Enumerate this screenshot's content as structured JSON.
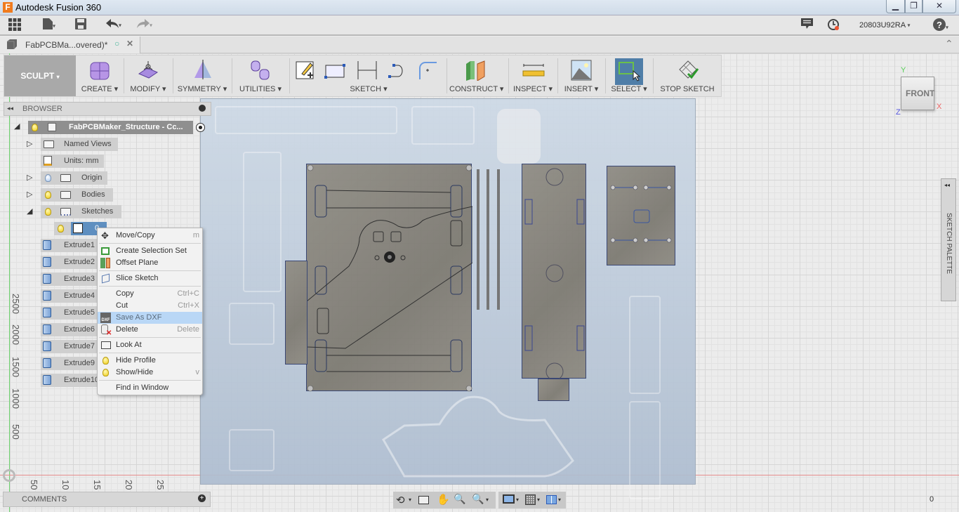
{
  "window": {
    "app_title": "Autodesk Fusion 360",
    "logo_letter": "F",
    "minimize": "▁",
    "restore": "❐",
    "close": "✕"
  },
  "app_toolbar": {
    "user": "20803U92RA",
    "icons": [
      "apps-grid-icon",
      "file-icon",
      "save-icon",
      "undo-icon",
      "redo-icon",
      "notifications-icon",
      "job-status-icon",
      "help-icon"
    ]
  },
  "doc_tab": {
    "name": "FabPCBMa...overed)*",
    "status_glyph": "○",
    "close_glyph": "✕",
    "collapse_glyph": "⌃"
  },
  "ribbon": {
    "workspace": "SCULPT",
    "groups": [
      {
        "label": "CREATE"
      },
      {
        "label": "MODIFY"
      },
      {
        "label": "SYMMETRY"
      },
      {
        "label": "UTILITIES"
      },
      {
        "label": "SKETCH"
      },
      {
        "label": "CONSTRUCT"
      },
      {
        "label": "INSPECT"
      },
      {
        "label": "INSERT"
      },
      {
        "label": "SELECT"
      },
      {
        "label": "STOP SKETCH"
      }
    ],
    "caret": "▾"
  },
  "browser": {
    "title": "BROWSER",
    "collapse_glyph": "◂◂",
    "root": "FabPCBMaker_Structure - Cc...",
    "items": [
      {
        "label": "Named Views"
      },
      {
        "label": "Units: mm"
      },
      {
        "label": "Origin"
      },
      {
        "label": "Bodies"
      },
      {
        "label": "Sketches"
      },
      {
        "label": "0"
      }
    ],
    "extrudes": [
      "Extrude1",
      "Extrude2",
      "Extrude3",
      "Extrude4",
      "Extrude5",
      "Extrude6",
      "Extrude7",
      "Extrude9",
      "Extrude10"
    ]
  },
  "context_menu": {
    "items": [
      {
        "label": "Move/Copy",
        "shortcut": "m"
      },
      {
        "label": "Create Selection Set",
        "shortcut": ""
      },
      {
        "label": "Offset Plane",
        "shortcut": ""
      },
      {
        "label": "Slice Sketch",
        "shortcut": ""
      },
      {
        "label": "Copy",
        "shortcut": "Ctrl+C"
      },
      {
        "label": "Cut",
        "shortcut": "Ctrl+X"
      },
      {
        "label": "Save As DXF",
        "shortcut": ""
      },
      {
        "label": "Delete",
        "shortcut": "Delete"
      },
      {
        "label": "Look At",
        "shortcut": ""
      },
      {
        "label": "Hide Profile",
        "shortcut": ""
      },
      {
        "label": "Show/Hide",
        "shortcut": "v"
      },
      {
        "label": "Find in Window",
        "shortcut": ""
      }
    ],
    "highlighted": "Save As DXF"
  },
  "viewcube": {
    "face": "FRONT",
    "axis_x": "X",
    "axis_y": "Y",
    "axis_z": "Z"
  },
  "sketch_palette": {
    "label": "SKETCH PALETTE",
    "collapse_glyph": "◂◂"
  },
  "rulers": {
    "vertical": [
      "2500",
      "2000",
      "1500",
      "1000",
      "500"
    ],
    "horizontal": [
      "50",
      "10",
      "15",
      "20",
      "25"
    ]
  },
  "comments": {
    "label": "COMMENTS",
    "add_glyph": "+"
  },
  "status": {
    "value": "0"
  }
}
